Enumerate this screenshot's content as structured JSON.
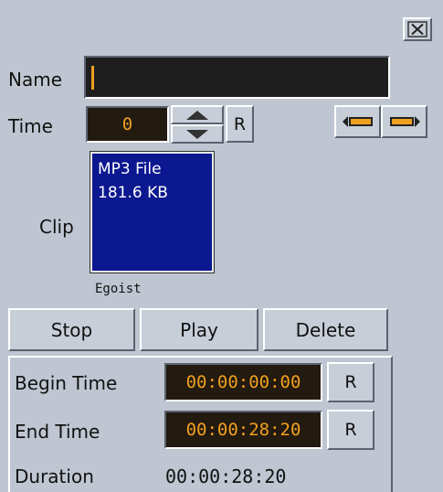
{
  "close_icon": "close-icon",
  "name": {
    "label": "Name",
    "value": ""
  },
  "time": {
    "label": "Time",
    "value": "0",
    "reset_label": "R",
    "icons": [
      "spin-up-icon",
      "spin-down-icon",
      "move-left-icon",
      "move-right-icon"
    ]
  },
  "clip": {
    "label": "Clip",
    "type": "MP3 File",
    "size": "181.6 KB",
    "title": "Egoist",
    "colors": {
      "box": "#0c1890",
      "text": "#ffffff"
    }
  },
  "controls": {
    "stop": "Stop",
    "play": "Play",
    "delete": "Delete"
  },
  "times": {
    "begin_label": "Begin Time",
    "begin_value": "00:00:00:00",
    "begin_reset": "R",
    "end_label": "End Time",
    "end_value": "00:00:28:20",
    "end_reset": "R",
    "duration_label": "Duration",
    "duration_value": "00:00:28:20"
  },
  "colors": {
    "panel": "#bfc6d1",
    "accent_orange": "#f0a020",
    "field_dark": "#1e1e1e"
  }
}
